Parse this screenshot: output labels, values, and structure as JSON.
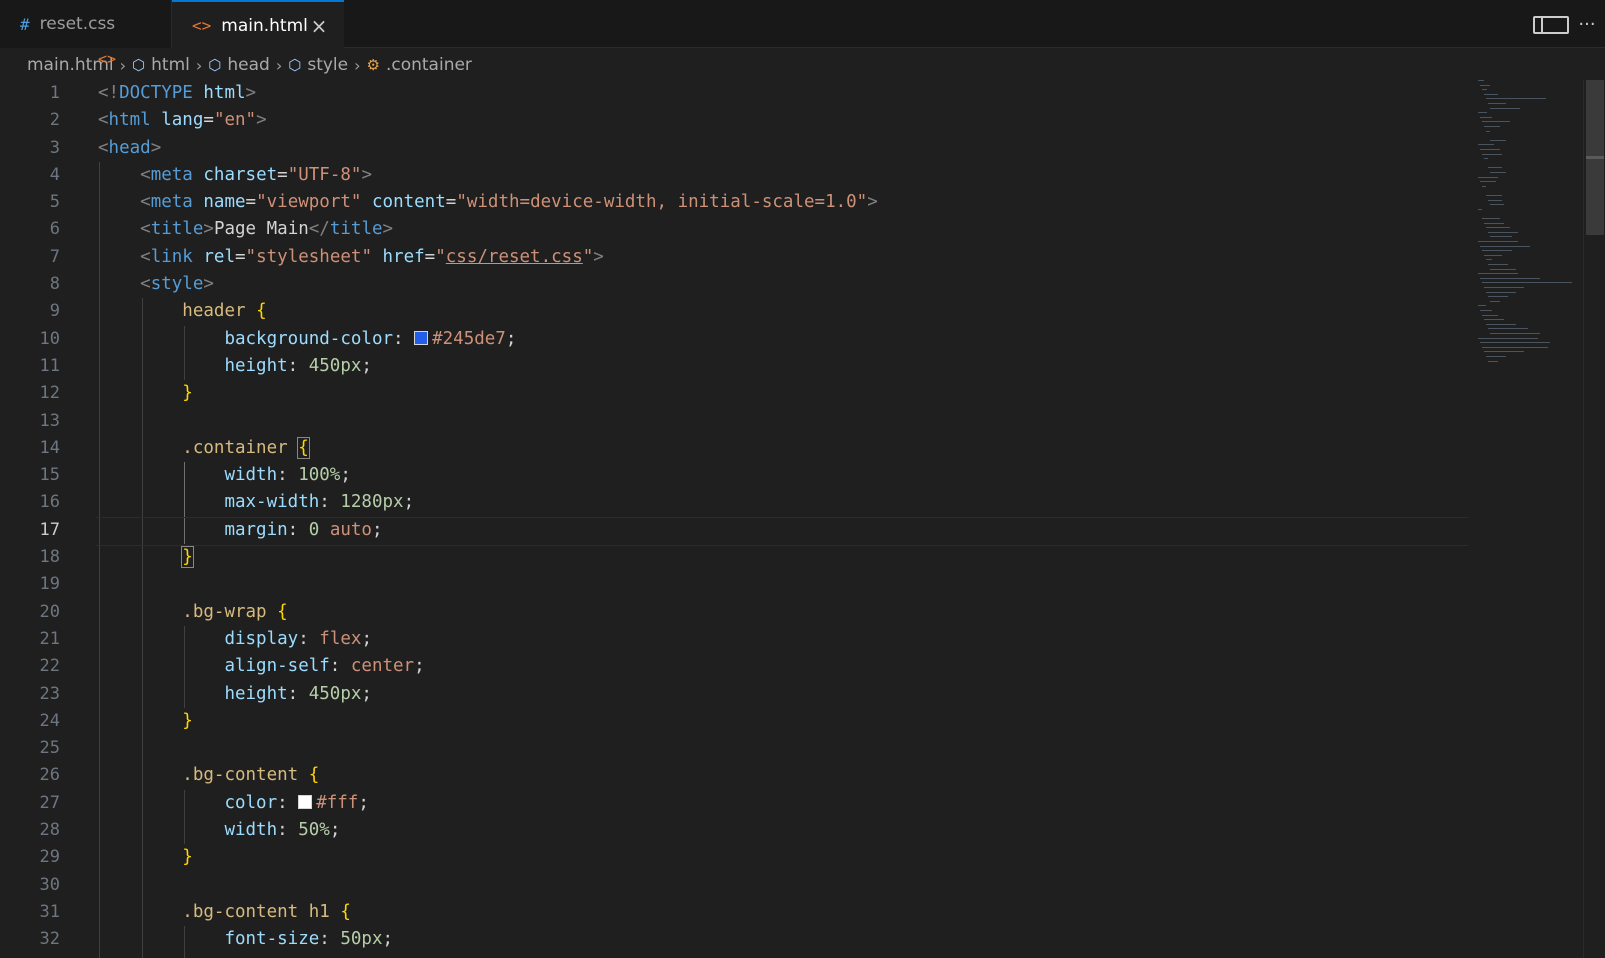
{
  "tabs": [
    {
      "label": "reset.css",
      "icon": "css-hash-icon",
      "glyph": "#",
      "active": false
    },
    {
      "label": "main.html",
      "icon": "html-code-icon",
      "glyph": "<>",
      "active": true,
      "close": "×"
    }
  ],
  "tab_actions": {
    "more": "···"
  },
  "breadcrumb": [
    {
      "label": "main.html",
      "icon": "html-code-icon"
    },
    {
      "label": "html",
      "icon": "element-cube-icon"
    },
    {
      "label": "head",
      "icon": "element-cube-icon"
    },
    {
      "label": "style",
      "icon": "element-cube-icon"
    },
    {
      "label": ".container",
      "icon": "css-selector-icon"
    }
  ],
  "editor": {
    "current_line": 17,
    "line_numbers": [
      "1",
      "2",
      "3",
      "4",
      "5",
      "6",
      "7",
      "8",
      "9",
      "10",
      "11",
      "12",
      "13",
      "14",
      "15",
      "16",
      "17",
      "18",
      "19",
      "20",
      "21",
      "22",
      "23",
      "24",
      "25",
      "26",
      "27",
      "28",
      "29",
      "30",
      "31",
      "32"
    ],
    "lines": [
      [
        [
          "punc",
          "<!"
        ],
        [
          "tag",
          "DOCTYPE "
        ],
        [
          "attr",
          "html"
        ],
        [
          "punc",
          ">"
        ]
      ],
      [
        [
          "punc",
          "<"
        ],
        [
          "tag",
          "html "
        ],
        [
          "attr",
          "lang"
        ],
        [
          "text",
          "="
        ],
        [
          "str",
          "\"en\""
        ],
        [
          "punc",
          ">"
        ]
      ],
      [
        [
          "punc",
          "<"
        ],
        [
          "tag",
          "head"
        ],
        [
          "punc",
          ">"
        ]
      ],
      [
        [
          "ws",
          "    "
        ],
        [
          "punc",
          "<"
        ],
        [
          "tag",
          "meta "
        ],
        [
          "attr",
          "charset"
        ],
        [
          "text",
          "="
        ],
        [
          "str",
          "\"UTF-8\""
        ],
        [
          "punc",
          ">"
        ]
      ],
      [
        [
          "ws",
          "    "
        ],
        [
          "punc",
          "<"
        ],
        [
          "tag",
          "meta "
        ],
        [
          "attr",
          "name"
        ],
        [
          "text",
          "="
        ],
        [
          "str",
          "\"viewport\" "
        ],
        [
          "attr",
          "content"
        ],
        [
          "text",
          "="
        ],
        [
          "str",
          "\"width=device-width, initial-scale=1.0\""
        ],
        [
          "punc",
          ">"
        ]
      ],
      [
        [
          "ws",
          "    "
        ],
        [
          "punc",
          "<"
        ],
        [
          "tag",
          "title"
        ],
        [
          "punc",
          ">"
        ],
        [
          "text",
          "Page Main"
        ],
        [
          "punc",
          "</"
        ],
        [
          "tag",
          "title"
        ],
        [
          "punc",
          ">"
        ]
      ],
      [
        [
          "ws",
          "    "
        ],
        [
          "punc",
          "<"
        ],
        [
          "tag",
          "link "
        ],
        [
          "attr",
          "rel"
        ],
        [
          "text",
          "="
        ],
        [
          "str",
          "\"stylesheet\" "
        ],
        [
          "attr",
          "href"
        ],
        [
          "text",
          "="
        ],
        [
          "str",
          "\""
        ],
        [
          "link",
          "css/reset.css"
        ],
        [
          "str",
          "\""
        ],
        [
          "punc",
          ">"
        ]
      ],
      [
        [
          "ws",
          "    "
        ],
        [
          "punc",
          "<"
        ],
        [
          "tag",
          "style"
        ],
        [
          "punc",
          ">"
        ]
      ],
      [
        [
          "ws",
          "        "
        ],
        [
          "sel",
          "header "
        ],
        [
          "brace",
          "{"
        ]
      ],
      [
        [
          "ws",
          "            "
        ],
        [
          "prop",
          "background-color"
        ],
        [
          "plain",
          ": "
        ],
        [
          "swatch",
          "#245de7"
        ],
        [
          "val",
          "#245de7"
        ],
        [
          "plain",
          ";"
        ]
      ],
      [
        [
          "ws",
          "            "
        ],
        [
          "prop",
          "height"
        ],
        [
          "plain",
          ": "
        ],
        [
          "num",
          "450px"
        ],
        [
          "plain",
          ";"
        ]
      ],
      [
        [
          "ws",
          "        "
        ],
        [
          "brace",
          "}"
        ]
      ],
      [],
      [
        [
          "ws",
          "        "
        ],
        [
          "sel",
          ".container "
        ],
        [
          "bracketm",
          "{"
        ]
      ],
      [
        [
          "ws",
          "            "
        ],
        [
          "prop",
          "width"
        ],
        [
          "plain",
          ": "
        ],
        [
          "num",
          "100%"
        ],
        [
          "plain",
          ";"
        ]
      ],
      [
        [
          "ws",
          "            "
        ],
        [
          "prop",
          "max-width"
        ],
        [
          "plain",
          ": "
        ],
        [
          "num",
          "1280px"
        ],
        [
          "plain",
          ";"
        ]
      ],
      [
        [
          "ws",
          "            "
        ],
        [
          "prop",
          "margin"
        ],
        [
          "plain",
          ": "
        ],
        [
          "num",
          "0 "
        ],
        [
          "val",
          "auto"
        ],
        [
          "plain",
          ";"
        ]
      ],
      [
        [
          "ws",
          "        "
        ],
        [
          "bracketm",
          "}"
        ]
      ],
      [],
      [
        [
          "ws",
          "        "
        ],
        [
          "sel",
          ".bg-wrap "
        ],
        [
          "brace",
          "{"
        ]
      ],
      [
        [
          "ws",
          "            "
        ],
        [
          "prop",
          "display"
        ],
        [
          "plain",
          ": "
        ],
        [
          "val",
          "flex"
        ],
        [
          "plain",
          ";"
        ]
      ],
      [
        [
          "ws",
          "            "
        ],
        [
          "prop",
          "align-self"
        ],
        [
          "plain",
          ": "
        ],
        [
          "val",
          "center"
        ],
        [
          "plain",
          ";"
        ]
      ],
      [
        [
          "ws",
          "            "
        ],
        [
          "prop",
          "height"
        ],
        [
          "plain",
          ": "
        ],
        [
          "num",
          "450px"
        ],
        [
          "plain",
          ";"
        ]
      ],
      [
        [
          "ws",
          "        "
        ],
        [
          "brace",
          "}"
        ]
      ],
      [],
      [
        [
          "ws",
          "        "
        ],
        [
          "sel",
          ".bg-content "
        ],
        [
          "brace",
          "{"
        ]
      ],
      [
        [
          "ws",
          "            "
        ],
        [
          "prop",
          "color"
        ],
        [
          "plain",
          ": "
        ],
        [
          "swatch",
          "#ffffff"
        ],
        [
          "val",
          "#fff"
        ],
        [
          "plain",
          ";"
        ]
      ],
      [
        [
          "ws",
          "            "
        ],
        [
          "prop",
          "width"
        ],
        [
          "plain",
          ": "
        ],
        [
          "num",
          "50%"
        ],
        [
          "plain",
          ";"
        ]
      ],
      [
        [
          "ws",
          "        "
        ],
        [
          "brace",
          "}"
        ]
      ],
      [],
      [
        [
          "ws",
          "        "
        ],
        [
          "sel",
          ".bg-content h1 "
        ],
        [
          "brace",
          "{"
        ]
      ],
      [
        [
          "ws",
          "            "
        ],
        [
          "prop",
          "font-size"
        ],
        [
          "plain",
          ": "
        ],
        [
          "num",
          "50px"
        ],
        [
          "plain",
          ";"
        ]
      ]
    ]
  },
  "colors": {
    "accent": "#0078d4",
    "background": "#1f1f1f",
    "tabbar": "#181818",
    "swatch_header_bg": "#245de7",
    "swatch_content_color": "#ffffff"
  }
}
